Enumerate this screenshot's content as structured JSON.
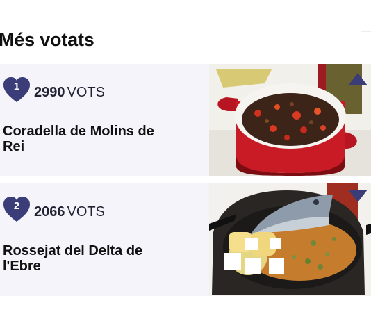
{
  "section": {
    "title": "Més votats"
  },
  "theme": {
    "accent": "#3b3d79",
    "card_bg": "#f4f4fa"
  },
  "items": [
    {
      "rank": "1",
      "votes": "2990",
      "votes_label": "VOTS",
      "name": "Coradella de Molins de Rei",
      "arrow_icon": "arrow-up-icon",
      "photo_icon": "red-casserole-dish-image"
    },
    {
      "rank": "2",
      "votes": "2066",
      "votes_label": "VOTS",
      "name": "Rossejat del Delta de l'Ebre",
      "arrow_icon": "arrow-down-icon",
      "photo_icon": "fish-rice-pan-image"
    }
  ]
}
